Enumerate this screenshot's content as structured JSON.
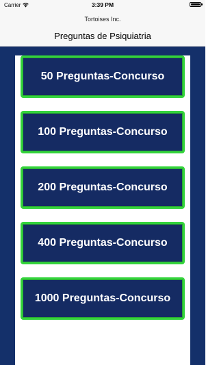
{
  "status_bar": {
    "carrier": "Carrier",
    "time": "3:39 PM"
  },
  "header": {
    "subtitle": "Tortoises Inc.",
    "title": "Preguntas de Psiquiatria"
  },
  "buttons": [
    {
      "label": "50 Preguntas-Concurso"
    },
    {
      "label": "100 Preguntas-Concurso"
    },
    {
      "label": "200 Preguntas-Concurso"
    },
    {
      "label": "400 Preguntas-Concurso"
    },
    {
      "label": "1000 Preguntas-Concurso"
    }
  ],
  "colors": {
    "frame_blue": "#14306a",
    "button_blue": "#152b63",
    "button_border_green": "#34d43c"
  }
}
